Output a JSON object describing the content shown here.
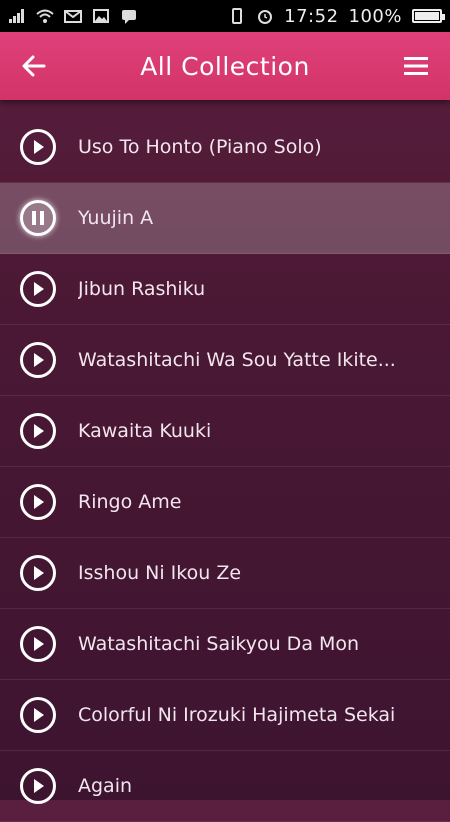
{
  "status_bar": {
    "icons": [
      "signal-icon",
      "wifi-icon",
      "mail-icon",
      "image-icon",
      "chat-icon",
      "phone-rotate-icon",
      "alarm-icon"
    ],
    "time": "17:52",
    "battery": "100%",
    "battery_level": 1.0
  },
  "app_bar": {
    "title": "All Collection",
    "back_icon": "arrow-left-icon",
    "menu_icon": "hamburger-menu-icon",
    "color": "#d83770"
  },
  "songs": [
    {
      "title": "Uso To Honto (Piano Solo)",
      "state": "play"
    },
    {
      "title": "Yuujin A",
      "state": "pause",
      "active": true
    },
    {
      "title": "Jibun Rashiku",
      "state": "play"
    },
    {
      "title": "Watashitachi Wa Sou Yatte Ikite...",
      "state": "play"
    },
    {
      "title": "Kawaita Kuuki",
      "state": "play"
    },
    {
      "title": "Ringo Ame",
      "state": "play"
    },
    {
      "title": "Isshou Ni Ikou Ze",
      "state": "play"
    },
    {
      "title": "Watashitachi Saikyou Da Mon",
      "state": "play"
    },
    {
      "title": "Colorful Ni Irozuki Hajimeta Sekai",
      "state": "play"
    },
    {
      "title": "Again",
      "state": "play"
    }
  ]
}
